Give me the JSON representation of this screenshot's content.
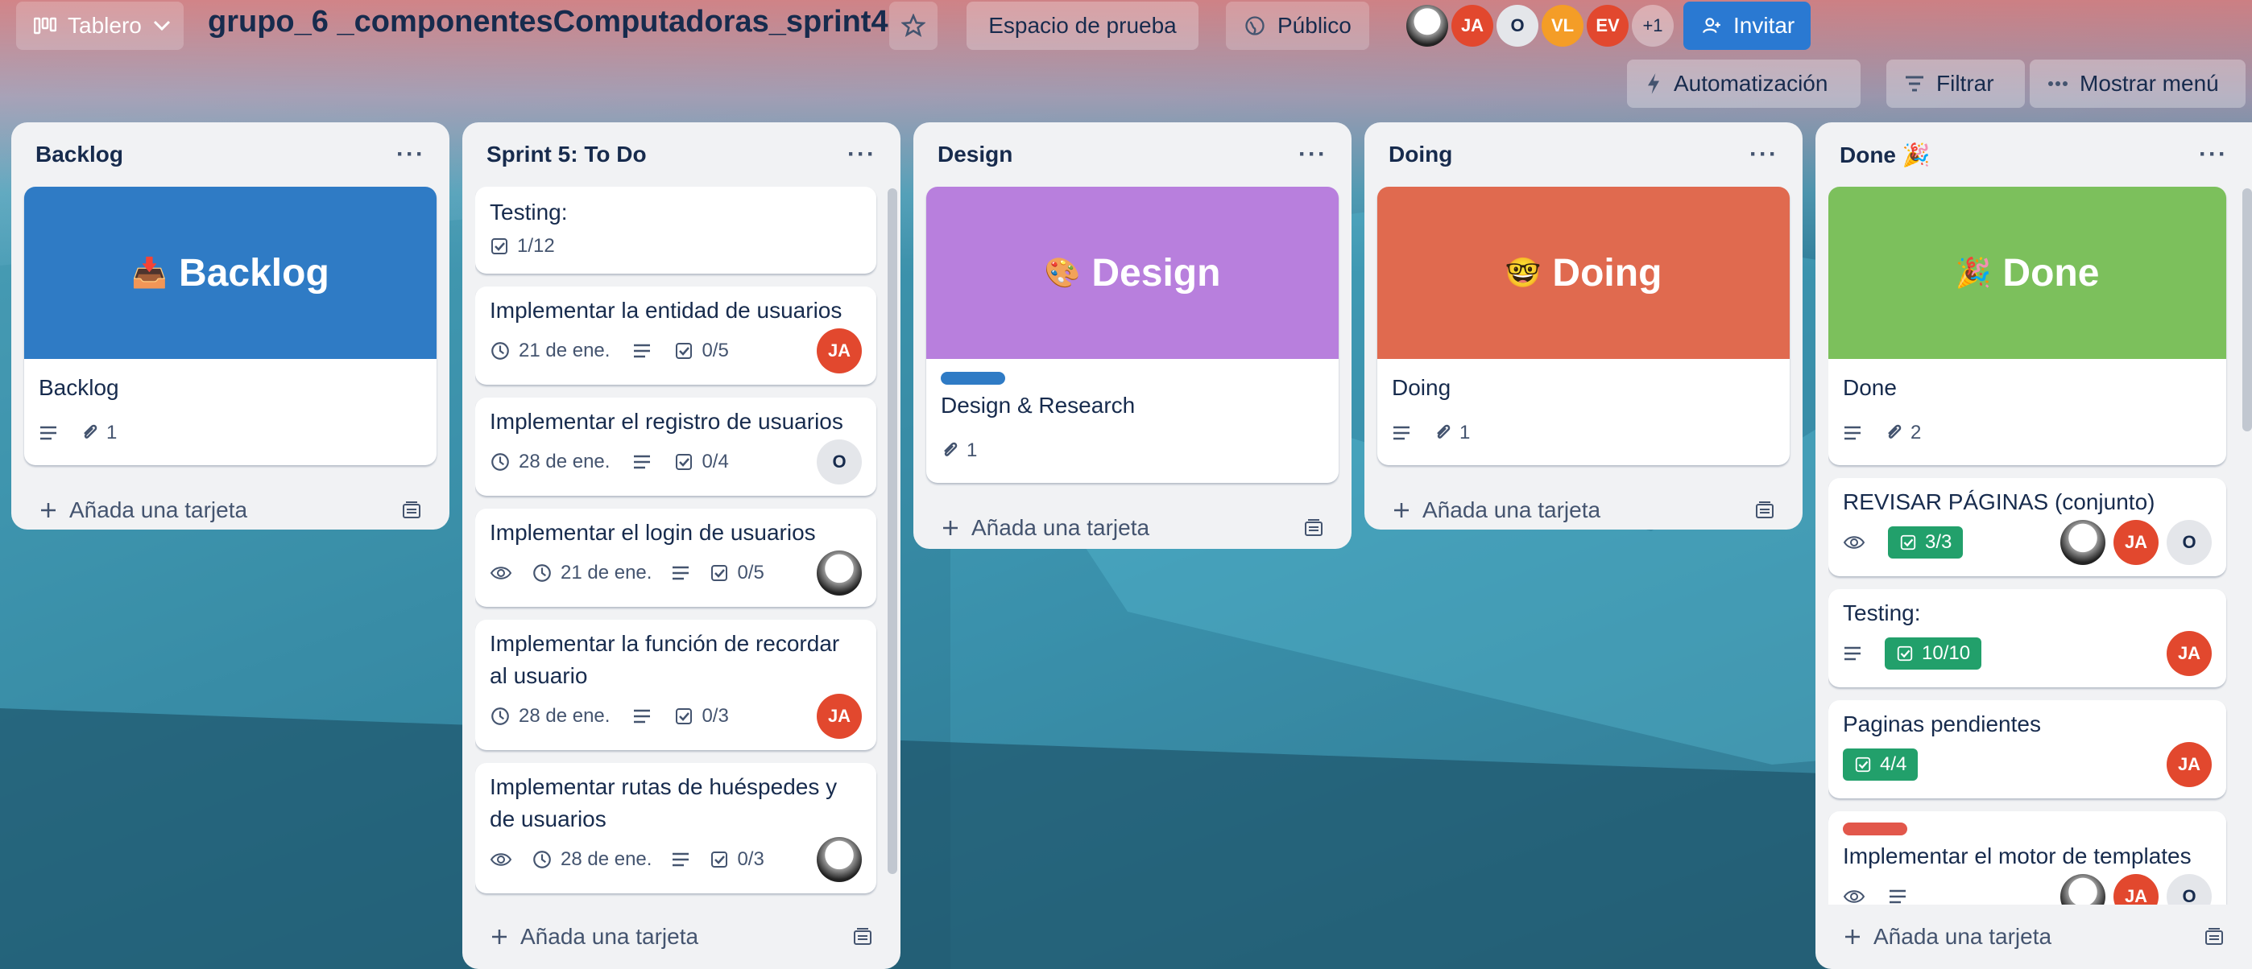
{
  "header": {
    "view_label": "Tablero",
    "board_title": "grupo_6 _componentesComputadoras_sprint4",
    "workspace": "Espacio de prueba",
    "visibility": "Público",
    "members": [
      "JA",
      "O",
      "VL",
      "EV"
    ],
    "members_more": "+1",
    "invite_label": "Invitar",
    "automation_label": "Automatización",
    "filter_label": "Filtrar",
    "menu_label": "Mostrar menú"
  },
  "lists": [
    {
      "title": "Backlog",
      "add_label": "Añada una tarjeta",
      "cards": [
        {
          "cover_text": "Backlog",
          "cover_emoji": "📥",
          "title": "Backlog",
          "attachments": "1"
        }
      ]
    },
    {
      "title": "Sprint 5: To Do",
      "add_label": "Añada una tarjeta",
      "cards": [
        {
          "title": "Testing:",
          "checklist": "1/12"
        },
        {
          "title": "Implementar la entidad de usuarios",
          "date": "21 de ene.",
          "checklist": "0/5",
          "member": "JA"
        },
        {
          "title": "Implementar el registro de usuarios",
          "date": "28 de ene.",
          "checklist": "0/4",
          "member": "O"
        },
        {
          "title": "Implementar el login de usuarios",
          "date": "21 de ene.",
          "checklist": "0/5"
        },
        {
          "title": "Implementar la función de recordar al usuario",
          "date": "28 de ene.",
          "checklist": "0/3",
          "member": "JA"
        },
        {
          "title": "Implementar rutas de huéspedes y de usuarios",
          "date": "28 de ene.",
          "checklist": "0/3"
        }
      ]
    },
    {
      "title": "Design",
      "add_label": "Añada una tarjeta",
      "cards": [
        {
          "cover_text": "Design",
          "cover_emoji": "🎨",
          "title": "Design & Research",
          "attachments": "1"
        }
      ]
    },
    {
      "title": "Doing",
      "add_label": "Añada una tarjeta",
      "cards": [
        {
          "cover_text": "Doing",
          "cover_emoji": "🤓",
          "title": "Doing",
          "attachments": "1"
        }
      ]
    },
    {
      "title": "Done 🎉",
      "add_label": "Añada una tarjeta",
      "cards": [
        {
          "cover_text": "Done",
          "cover_emoji": "🎉",
          "title": "Done",
          "attachments": "2"
        },
        {
          "title": "REVISAR PÁGINAS (conjunto)",
          "checklist": "3/3",
          "members": [
            "JA",
            "O"
          ]
        },
        {
          "title": "Testing:",
          "checklist": "10/10",
          "member": "JA"
        },
        {
          "title": "Paginas pendientes",
          "checklist": "4/4",
          "member": "JA"
        },
        {
          "title": "Implementar el motor de templates"
        }
      ]
    }
  ],
  "colors": {
    "backlog_cover": "#2f7bc5",
    "design_cover": "#b87fdd",
    "doing_cover": "#e06a4f",
    "done_cover": "#7cc05c",
    "design_label": "#2f7bc5",
    "done_label": "#e2574b"
  },
  "icons": [
    "board-icon",
    "chevron-down-icon",
    "star-icon",
    "globe-icon",
    "add-user-icon",
    "lightning-icon",
    "filter-icon",
    "more-icon",
    "description-icon",
    "attachment-icon",
    "checklist-icon",
    "clock-icon",
    "eye-icon",
    "plus-icon",
    "template-icon"
  ]
}
